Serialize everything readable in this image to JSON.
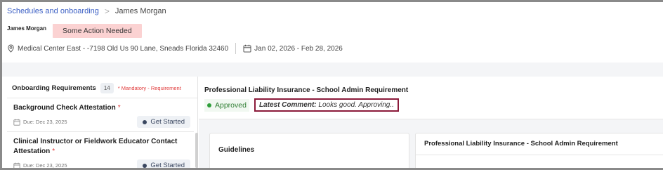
{
  "breadcrumb": {
    "parent": "Schedules and onboarding",
    "separator": ">",
    "current": "James Morgan"
  },
  "person": {
    "name": "James Morgan",
    "status": "Some Action Needed"
  },
  "meta": {
    "location": "Medical Center East - -7198 Old Us 90 Lane, Sneads Florida 32460",
    "date_range": "Jan 02, 2026 - Feb 28, 2026"
  },
  "sidebar": {
    "title": "Onboarding Requirements",
    "count": "14",
    "mandatory_note": "* Mandatory - Requirement",
    "items": [
      {
        "title": "Background Check Attestation",
        "star": "*",
        "due": "Due: Dec 23, 2025",
        "action": "Get Started"
      },
      {
        "title": "Clinical Instructor or Fieldwork Educator Contact Attestation",
        "star": "*",
        "due": "Due: Dec 23, 2025",
        "action": "Get Started"
      }
    ]
  },
  "main": {
    "title": "Professional Liability Insurance - School Admin Requirement",
    "status": "Approved",
    "comment_label": "Latest Comment:",
    "comment_text": "Looks good. Approving..",
    "guidelines_label": "Guidelines",
    "doc_card_title": "Professional Liability Insurance - School Admin Requirement"
  },
  "colors": {
    "link": "#3b5fc4",
    "status_tag_bg": "#fbd2d2",
    "approved": "#2e7d32",
    "mandatory": "#e03a3a",
    "comment_border": "#8b1a3a"
  },
  "icons": {
    "location": "location-pin-icon",
    "calendar": "calendar-icon",
    "breadcrumb_separator": "chevron-right-icon"
  }
}
